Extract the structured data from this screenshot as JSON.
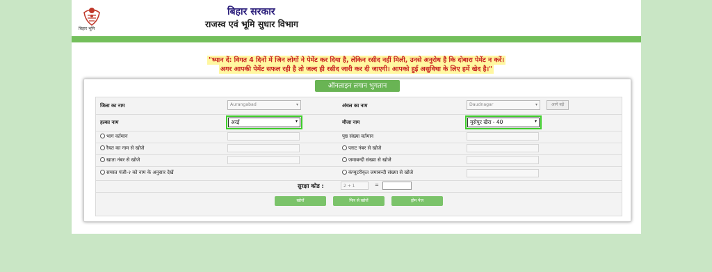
{
  "header": {
    "logo_caption": "बिहार भूमि",
    "gov_title": "बिहार सरकार",
    "dept_title": "राजस्व एवं भूमि सुधार विभाग"
  },
  "notice": {
    "line1": "\"ध्यान दें: विगत 4 दिनों में जिन लोगों ने पेमेंट कर दिया है, लेकिन रसीद नहीं मिली, उनसे अनुरोध है कि दोबारा पेमेंट न करें।",
    "line2": "अगर आपकी पेमेंट सफल रही है तो जल्द ही रसीद जारी कर दी जाएगी। आपको हुई असुविधा के लिए हमें खेद है।\""
  },
  "form": {
    "title": "ऑनलाइन लगान भुगतान",
    "district_label": "जिला का नाम",
    "district_value": "Aurangabad",
    "circle_label": "अंचल का नाम",
    "circle_value": "Daudnagar",
    "aage_label": "आगे बढ़ें",
    "halka_label": "हल्का नाम",
    "halka_value": "अरई",
    "mauja_label": "मौजा नाम",
    "mauja_value": "मुसेपुर खैरा - 40",
    "bhag_label": "भाग वर्तमान",
    "page_label": "पृष्ठ संख्या वर्तमान",
    "raiyat_label": "रैयत का नाम से खोजे",
    "plot_label": "प्लाट नंबर से खोजे",
    "khata_label": "खाता नंबर से खोजे",
    "jamabandi_label": "जमाबन्दी संख्या से खोजे",
    "samast_label": "समस्त पंजी-२ को नाम के अनुसार देखें",
    "computer_label": "कंप्यूटरीकृत जमाबन्दी संख्या से खोजे",
    "captcha_label": "सुरक्षा कोड :",
    "captcha_question": "2 + 1",
    "equals": "=",
    "search_btn": "खोजें",
    "research_btn": "फिर से खोजें",
    "home_btn": "होम पेज"
  },
  "colors": {
    "accent_green": "#73bf5b",
    "highlight_green": "#3fce2c",
    "notice_red": "#c8201f",
    "notice_bg": "#fff7a0"
  }
}
